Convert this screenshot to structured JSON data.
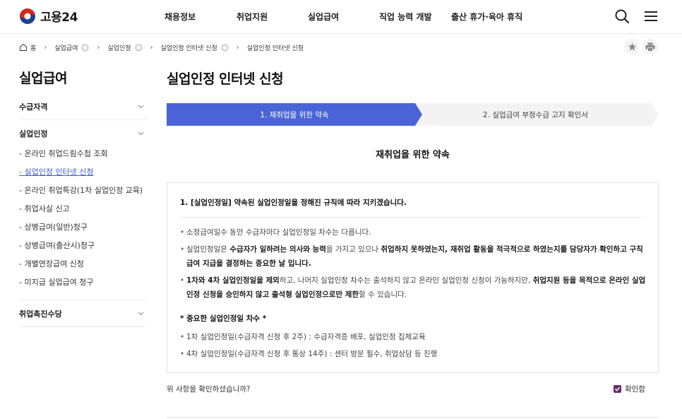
{
  "header": {
    "logo_text": "고용24",
    "nav": [
      "채용정보",
      "취업지원",
      "실업급여",
      "직업 능력 개발",
      "출산 휴가·육아 휴직"
    ],
    "search_icon": "search-icon",
    "menu_icon": "menu-icon"
  },
  "breadcrumb": {
    "home": "홈",
    "items": [
      "실업급여",
      "실업인정",
      "실업인정 인터넷 신청",
      "실업인정 인터넷 신청"
    ]
  },
  "side": {
    "title": "실업급여",
    "groups": [
      {
        "label": "수급자격",
        "expanded": false,
        "items": []
      },
      {
        "label": "실업인정",
        "expanded": true,
        "items": [
          "- 온라인 취업드림수첩 조회",
          "- 실업인정 인터넷 신청",
          "- 온라인 취업특강(1차 실업인정 교육)",
          "- 취업사실 신고",
          "- 상병급여(일반)청구",
          "- 상병급여(출산시)청구",
          "- 개별연장급여 신청",
          "- 미지급 실업급여 청구"
        ],
        "active_index": 1
      },
      {
        "label": "취업촉진수당",
        "expanded": false,
        "items": []
      }
    ]
  },
  "main": {
    "title": "실업인정 인터넷 신청",
    "steps": [
      "1. 재취업을 위한 약속",
      "2. 실업급여 부정수급 고지 확인서"
    ],
    "section_title": "재취업을 위한 약속",
    "box_head": "1. [실업인정일] 약속된 실업인정일을 정해진 규칙에 따라 지키겠습니다.",
    "bullet1": "소정급여일수 동안 수급자마다 실업인정일 차수는 다릅니다.",
    "bullet2": {
      "p1": "실업인정일은 ",
      "b1": "수급자가 일하려는 의사와 능력",
      "p2": "을 가지고 있으나 ",
      "b2": "취업하지 못하였는지, 재취업 활동을 적극적으로 하였는지를 담당자가 확인하고 구직급여 지급을 결정하는 중요한 날 입니다."
    },
    "bullet3": {
      "b1": "1차와 4차 실업인정일을 제외",
      "p1": "하고, 나머지 실업인정 차수는 출석하지 않고 온라인 실업인정 신청이 가능하지만, ",
      "b2": "취업지원 등을 목적으로 온라인 실업인정 신청을 승인하지 않고 출석형 실업인정으로만 제한",
      "p2": "할 수 있습니다."
    },
    "important_title": "* 중요한 실업인정일 차수 *",
    "important_items": [
      "1차 실업인정일(수급자격 신청 후 2주) : 수급자격증 배포, 실업인정 집체교육",
      "4차 실업인정일(수급자격 신청 후 통상 14주) : 센터 방문 필수, 취업상담 등 진행"
    ],
    "confirm_question": "위 사항을 확인하셨습니까?",
    "confirm_label": "확인함",
    "confirm_checked": true
  },
  "colors": {
    "accent": "#4a64d8",
    "active_link": "#3f5dd6",
    "checkbox": "#6b2a77"
  }
}
